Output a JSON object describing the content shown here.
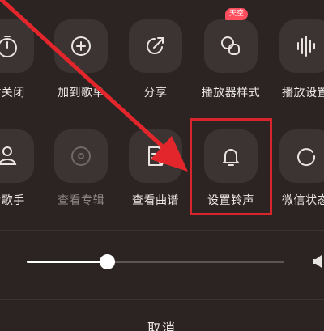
{
  "row1": [
    {
      "label": "时关闭",
      "icon": "timer-icon"
    },
    {
      "label": "加到歌单",
      "icon": "add-to-playlist-icon"
    },
    {
      "label": "分享",
      "icon": "share-icon"
    },
    {
      "label": "播放器样式",
      "icon": "player-style-icon",
      "badge": "天空"
    },
    {
      "label": "播放设置",
      "icon": "play-settings-icon"
    }
  ],
  "row2": [
    {
      "label": "看歌手",
      "icon": "singer-icon"
    },
    {
      "label": "查看专辑",
      "icon": "album-icon",
      "disabled": true
    },
    {
      "label": "查看曲谱",
      "icon": "sheet-music-icon"
    },
    {
      "label": "设置铃声",
      "icon": "bell-icon"
    },
    {
      "label": "微信状态",
      "icon": "wechat-status-icon"
    }
  ],
  "volume": {
    "level": 0.31
  },
  "cancel_label": "取消",
  "colors": {
    "background": "#2b2423",
    "tile": "#3b3433",
    "highlight": "#d7262b",
    "badge": "#ff4f5e"
  }
}
